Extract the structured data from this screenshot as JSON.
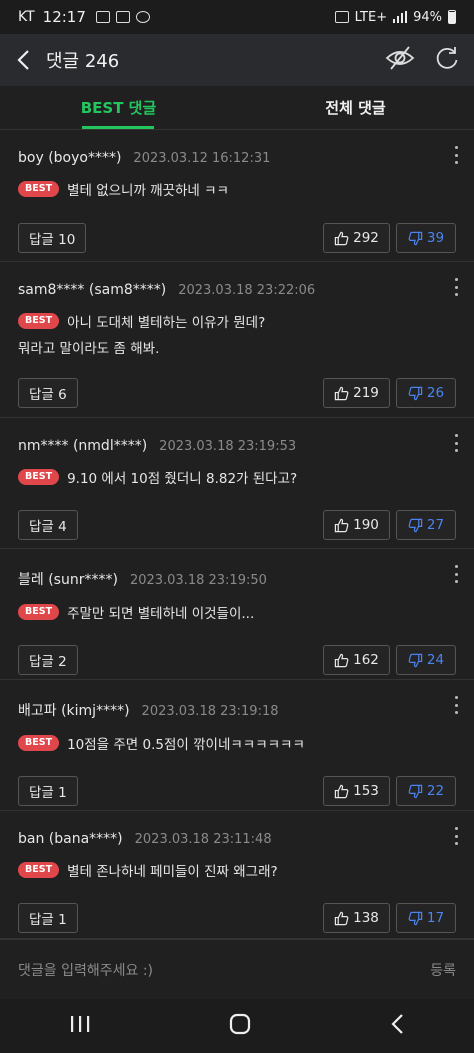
{
  "status_bar": {
    "carrier": "KT",
    "time": "12:17",
    "network": "LTE+",
    "battery": "94%"
  },
  "header": {
    "title": "댓글 246"
  },
  "tabs": [
    {
      "label": "BEST 댓글",
      "active": true
    },
    {
      "label": "전체 댓글",
      "active": false
    }
  ],
  "badge_label": "BEST",
  "comments": [
    {
      "author": "boy (boyo****)",
      "date": "2023.03.12 16:12:31",
      "text": "별테 없으니까 깨끗하네 ㅋㅋ",
      "text2": "",
      "reply": "답글 10",
      "likes": "292",
      "dislikes": "39"
    },
    {
      "author": "sam8**** (sam8****)",
      "date": "2023.03.18 23:22:06",
      "text": "아니 도대체 별테하는 이유가 뭔데?",
      "text2": "뭐라고 말이라도 좀 해봐.",
      "reply": "답글 6",
      "likes": "219",
      "dislikes": "26"
    },
    {
      "author": "nm**** (nmdl****)",
      "date": "2023.03.18 23:19:53",
      "text": "9.10 에서 10점 줬더니 8.82가 된다고?",
      "text2": "",
      "reply": "답글 4",
      "likes": "190",
      "dislikes": "27"
    },
    {
      "author": "블레 (sunr****)",
      "date": "2023.03.18 23:19:50",
      "text": "주말만 되면 별테하네 이것들이...",
      "text2": "",
      "reply": "답글 2",
      "likes": "162",
      "dislikes": "24"
    },
    {
      "author": "배고파 (kimj****)",
      "date": "2023.03.18 23:19:18",
      "text": "10점을 주면 0.5점이 깎이네ㅋㅋㅋㅋㅋㅋ",
      "text2": "",
      "reply": "답글 1",
      "likes": "153",
      "dislikes": "22"
    },
    {
      "author": "ban (bana****)",
      "date": "2023.03.18 23:11:48",
      "text": "별테 존나하네 페미들이 진짜 왜그래?",
      "text2": "",
      "reply": "답글 1",
      "likes": "138",
      "dislikes": "17"
    }
  ],
  "input": {
    "placeholder": "댓글을 입력해주세요 :)",
    "submit": "등록"
  },
  "colors": {
    "accent": "#22c55e",
    "best_badge": "#e0474b",
    "dislike": "#4b83f0"
  }
}
